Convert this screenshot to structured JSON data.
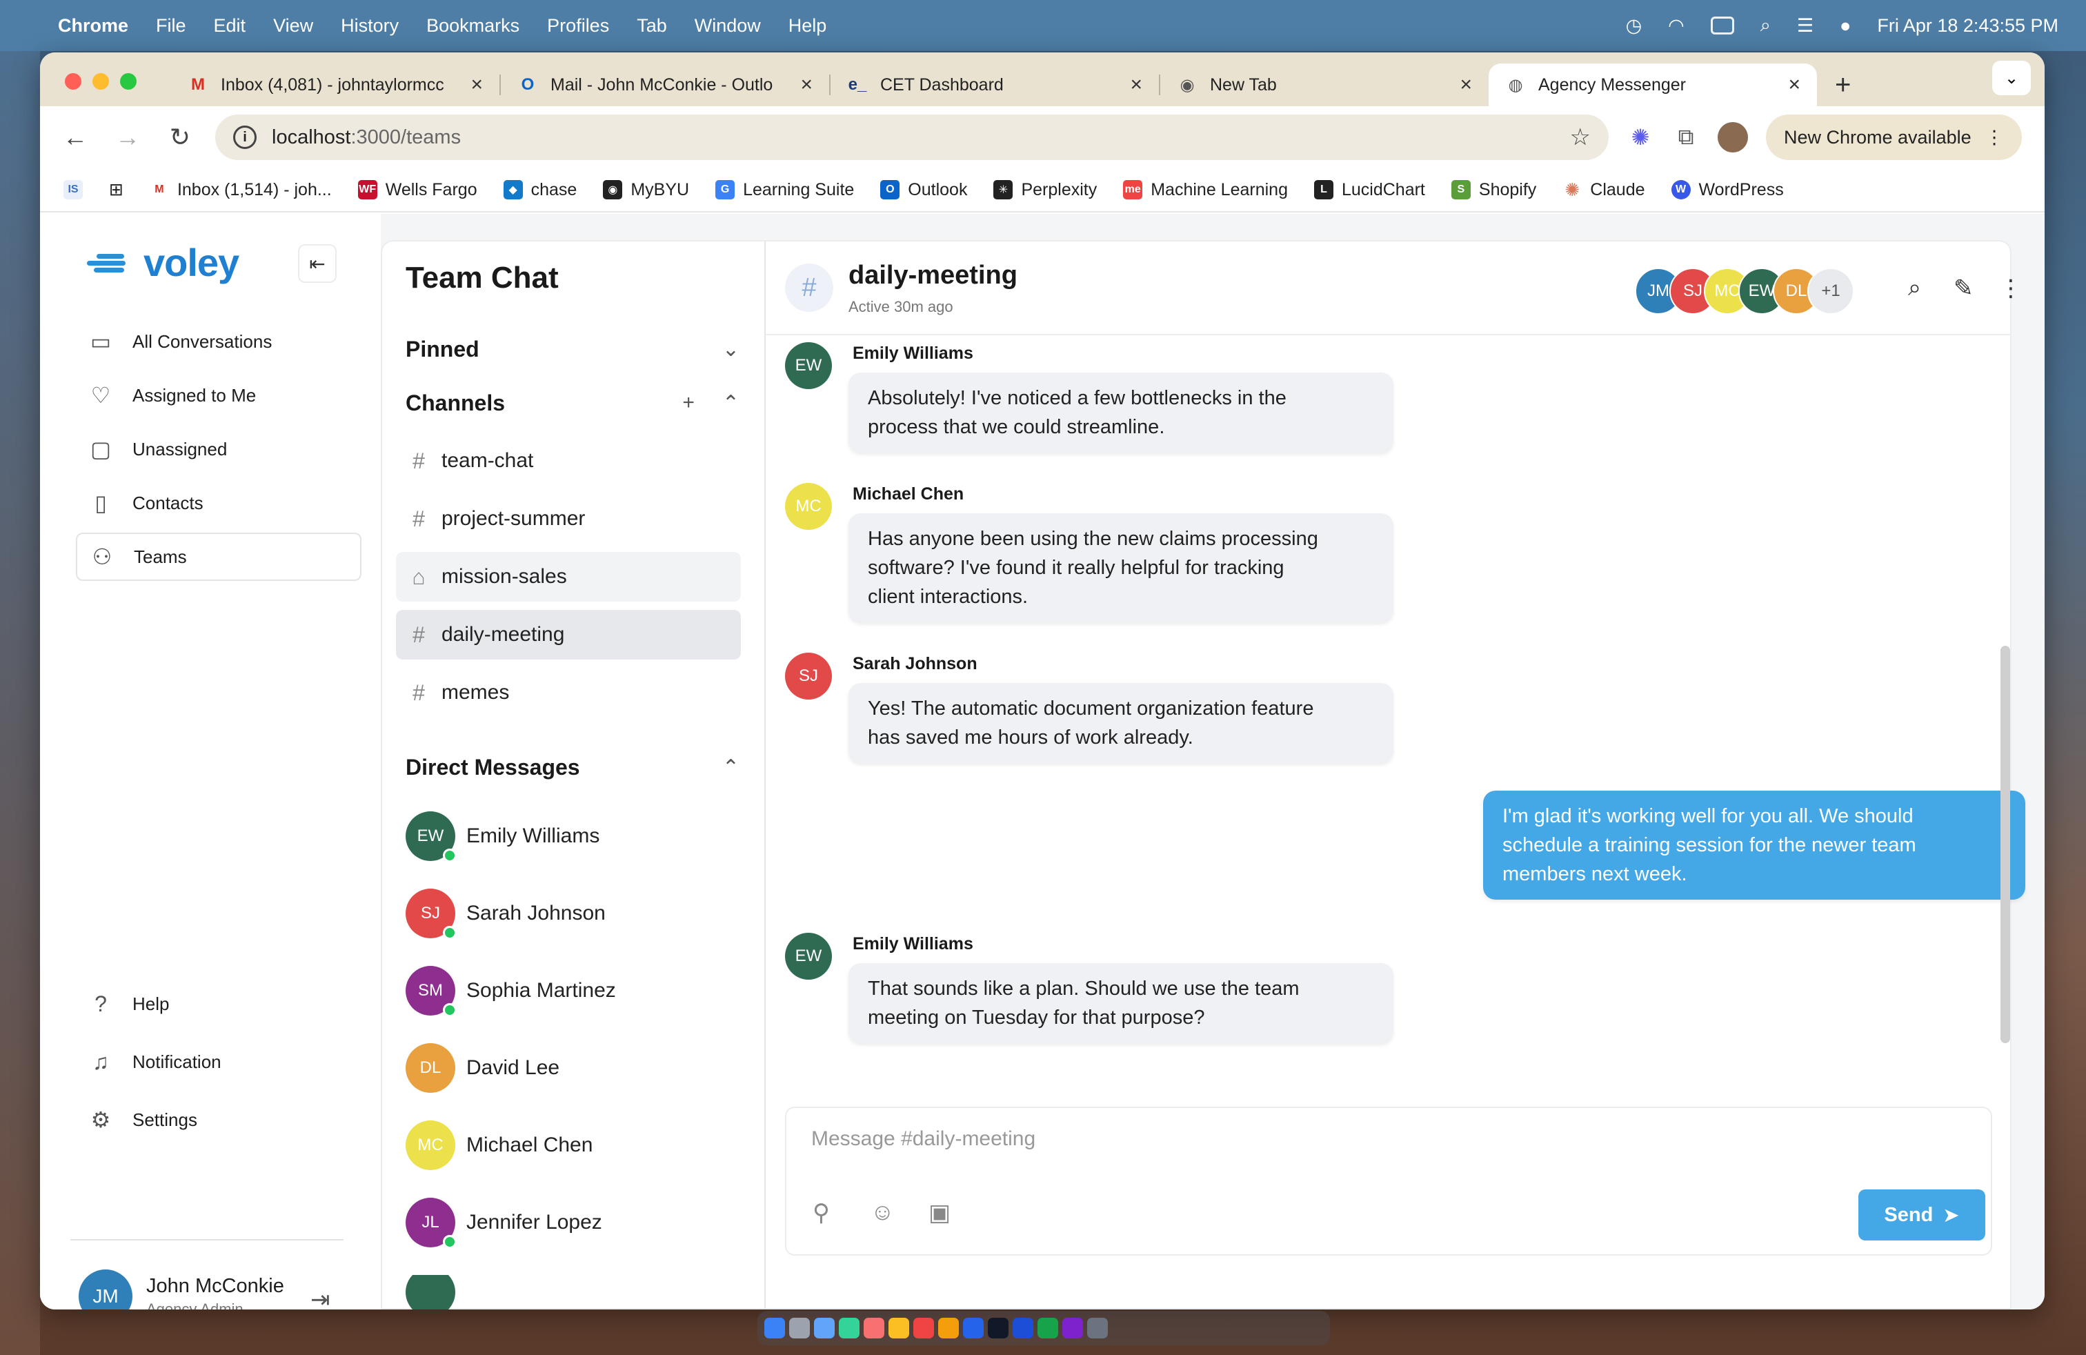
{
  "menubar": {
    "app": "Chrome",
    "items": [
      "File",
      "Edit",
      "View",
      "History",
      "Bookmarks",
      "Profiles",
      "Tab",
      "Window",
      "Help"
    ],
    "clock": "Fri Apr 18  2:43:55 PM"
  },
  "browser": {
    "tabs": [
      {
        "title": "Inbox (4,081) - johntaylormcc",
        "favicon": "M",
        "favicon_color": "#d93025"
      },
      {
        "title": "Mail - John McConkie - Outlo",
        "favicon": "O",
        "favicon_color": "#0a64c9"
      },
      {
        "title": "CET Dashboard",
        "favicon": "e_",
        "favicon_color": "#1b3a7a"
      },
      {
        "title": "New Tab",
        "favicon": "◉",
        "favicon_color": "#555555"
      },
      {
        "title": "Agency Messenger",
        "favicon": "◍",
        "favicon_color": "#555555"
      }
    ],
    "url_host": "localhost",
    "url_path": ":3000/teams",
    "update_label": "New Chrome available",
    "bookmarks": [
      {
        "label": "Inbox (1,514) - joh...",
        "icon_color": "#d93025",
        "icon": "M"
      },
      {
        "label": "Wells Fargo",
        "icon_color": "#c8102e",
        "icon": "WF"
      },
      {
        "label": "chase",
        "icon_color": "#117aca",
        "icon": "◆"
      },
      {
        "label": "MyBYU",
        "icon_color": "#222222",
        "icon": "◉"
      },
      {
        "label": "Learning Suite",
        "icon_color": "#3b82f6",
        "icon": "G"
      },
      {
        "label": "Outlook",
        "icon_color": "#0a64c9",
        "icon": "O"
      },
      {
        "label": "Perplexity",
        "icon_color": "#222222",
        "icon": "✳"
      },
      {
        "label": "Machine Learning",
        "icon_color": "#ef4444",
        "icon": "me"
      },
      {
        "label": "LucidChart",
        "icon_color": "#222222",
        "icon": "L"
      },
      {
        "label": "Shopify",
        "icon_color": "#5a9e3a",
        "icon": "S"
      },
      {
        "label": "Claude",
        "icon_color": "#d97757",
        "icon": "✺"
      },
      {
        "label": "WordPress",
        "icon_color": "#3858e9",
        "icon": "W"
      }
    ]
  },
  "sidebar": {
    "logo": "voley",
    "nav": [
      {
        "label": "All Conversations",
        "icon": "inbox-icon"
      },
      {
        "label": "Assigned to Me",
        "icon": "assigned-icon"
      },
      {
        "label": "Unassigned",
        "icon": "chat-bubble-icon"
      },
      {
        "label": "Contacts",
        "icon": "contact-card-icon"
      },
      {
        "label": "Teams",
        "icon": "users-icon"
      }
    ],
    "bottom": [
      {
        "label": "Help",
        "icon": "help-icon"
      },
      {
        "label": "Notification",
        "icon": "bell-icon"
      },
      {
        "label": "Settings",
        "icon": "gear-icon"
      }
    ],
    "user": {
      "initials": "JM",
      "name": "John McConkie",
      "role": "Agency Admin"
    }
  },
  "team_chat": {
    "title": "Team Chat",
    "pinned_label": "Pinned",
    "channels_label": "Channels",
    "channels": [
      {
        "name": "team-chat",
        "icon": "#"
      },
      {
        "name": "project-summer",
        "icon": "#"
      },
      {
        "name": "mission-sales",
        "icon": "lock"
      },
      {
        "name": "daily-meeting",
        "icon": "#"
      },
      {
        "name": "memes",
        "icon": "#"
      }
    ],
    "dm_label": "Direct Messages",
    "dms": [
      {
        "initials": "EW",
        "name": "Emily Williams",
        "color": "#2f6b52",
        "online": true
      },
      {
        "initials": "SJ",
        "name": "Sarah Johnson",
        "color": "#e24a4a",
        "online": true
      },
      {
        "initials": "SM",
        "name": "Sophia Martinez",
        "color": "#8e2f8f",
        "online": true
      },
      {
        "initials": "DL",
        "name": "David Lee",
        "color": "#e9a03f",
        "online": false
      },
      {
        "initials": "MC",
        "name": "Michael Chen",
        "color": "#ece14a",
        "online": false
      },
      {
        "initials": "JL",
        "name": "Jennifer Lopez",
        "color": "#8e2f8f",
        "online": true
      }
    ]
  },
  "chat": {
    "channel": "daily-meeting",
    "status": "Active 30m ago",
    "members": [
      {
        "initials": "JM",
        "color": "#2f7fb8"
      },
      {
        "initials": "SJ",
        "color": "#e24a4a"
      },
      {
        "initials": "MC",
        "color": "#ece14a"
      },
      {
        "initials": "EW",
        "color": "#2f6b52"
      },
      {
        "initials": "DL",
        "color": "#e9a03f"
      },
      {
        "initials": "+1",
        "color": "#e8eaee"
      }
    ],
    "messages": [
      {
        "author": "Emily Williams",
        "initials": "EW",
        "color": "#2f6b52",
        "line1": "Absolutely! I've noticed a few bottlenecks in the",
        "line2": "process that we could streamline.",
        "line3": ""
      },
      {
        "author": "Michael Chen",
        "initials": "MC",
        "color": "#ece14a",
        "line1": "Has anyone been using the new claims processing",
        "line2": "software? I've found it really helpful for tracking",
        "line3": "client interactions."
      },
      {
        "author": "Sarah Johnson",
        "initials": "SJ",
        "color": "#e24a4a",
        "line1": "Yes! The automatic document organization feature",
        "line2": "has saved me hours of work already.",
        "line3": ""
      },
      {
        "author": "",
        "initials": "",
        "color": "#45a8e6",
        "line1": "I'm glad it's working well for you all. We should",
        "line2": "schedule a training session for the newer team",
        "line3": "members next week."
      },
      {
        "author": "Emily Williams",
        "initials": "EW",
        "color": "#2f6b52",
        "line1": "That sounds like a plan. Should we use the team",
        "line2": "meeting on Tuesday for that purpose?",
        "line3": ""
      }
    ],
    "composer_placeholder": "Message #daily-meeting",
    "send_label": "Send"
  }
}
